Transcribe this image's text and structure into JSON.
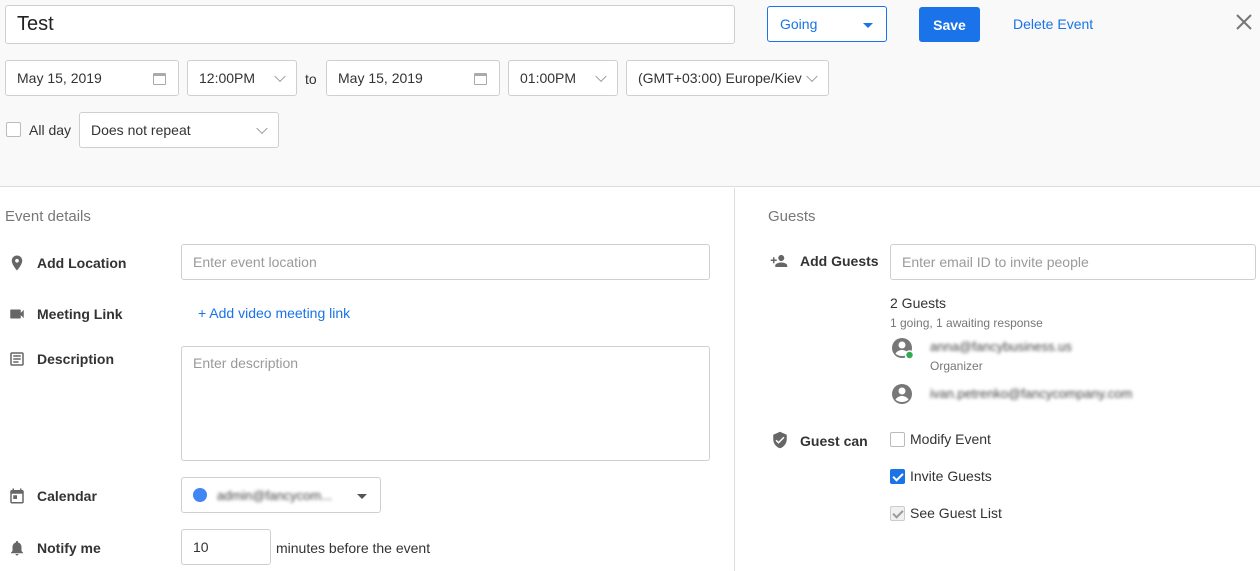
{
  "header": {
    "title_value": "Test",
    "status_value": "Going",
    "save_label": "Save",
    "delete_label": "Delete Event"
  },
  "datetime": {
    "start_date": "May 15, 2019",
    "start_time": "12:00PM",
    "to_label": "to",
    "end_date": "May 15, 2019",
    "end_time": "01:00PM",
    "timezone": "(GMT+03:00) Europe/Kiev",
    "all_day_label": "All day",
    "repeat_value": "Does not repeat"
  },
  "details": {
    "section_title": "Event details",
    "location_label": "Add Location",
    "location_placeholder": "Enter event location",
    "meeting_label": "Meeting Link",
    "meeting_link_text": "+ Add video meeting link",
    "description_label": "Description",
    "description_placeholder": "Enter description",
    "calendar_label": "Calendar",
    "calendar_value": "admin@fancycom...",
    "notify_label": "Notify me",
    "notify_value": "10",
    "notify_suffix": "minutes before the event"
  },
  "guests": {
    "section_title": "Guests",
    "add_label": "Add Guests",
    "email_placeholder": "Enter email ID to invite people",
    "count_text": "2 Guests",
    "status_text": "1 going, 1 awaiting response",
    "list": [
      {
        "email": "anna@fancybusiness.us",
        "role": "Organizer"
      },
      {
        "email": "ivan.petrenko@fancycompany.com",
        "role": ""
      }
    ],
    "permissions_label": "Guest can",
    "permissions": [
      {
        "label": "Modify Event",
        "checked": false
      },
      {
        "label": "Invite Guests",
        "checked": true
      },
      {
        "label": "See Guest List",
        "checked": true
      }
    ]
  },
  "colors": {
    "accent": "#1a73e8",
    "calendar_dot": "#4285f4",
    "going_badge": "#34a853"
  }
}
